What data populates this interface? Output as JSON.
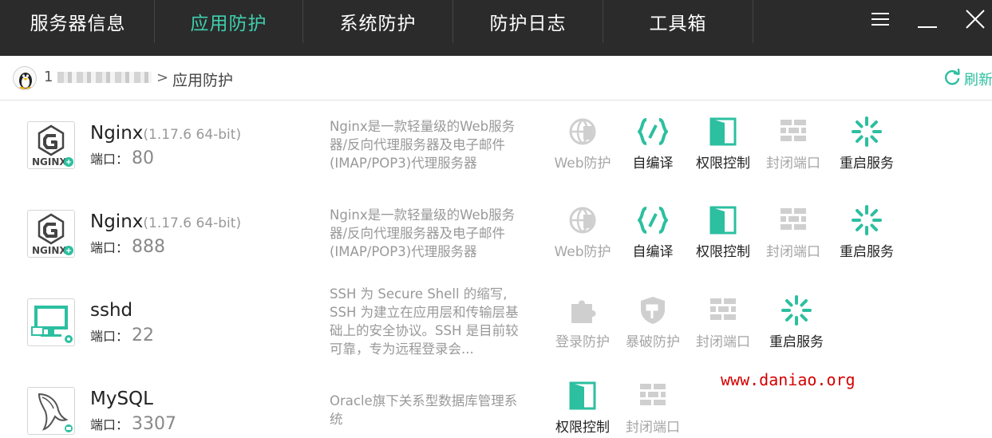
{
  "nav": {
    "tabs": [
      {
        "label": "服务器信息",
        "active": false
      },
      {
        "label": "应用防护",
        "active": true
      },
      {
        "label": "系统防护",
        "active": false
      },
      {
        "label": "防护日志",
        "active": false
      },
      {
        "label": "工具箱",
        "active": false
      }
    ]
  },
  "breadcrumb": {
    "host_prefix": "1",
    "host_suffix": "",
    "separator": ">",
    "page": "应用防护",
    "refresh_label": "刷新"
  },
  "colors": {
    "accent": "#3fd0b0",
    "icon_on": "#2cbfa0",
    "icon_off": "#cfcfcf",
    "nav_bg": "#2b2b2b",
    "watermark": "#d40000"
  },
  "apps": [
    {
      "name": "Nginx",
      "version": "(1.17.6 64-bit)",
      "port_label": "端口：",
      "port": "80",
      "description": "Nginx是一款轻量级的Web服务器/反向代理服务器及电子邮件(IMAP/POP3)代理服务器",
      "icon": "nginx-logo-icon",
      "actions": [
        {
          "label": "Web防护",
          "icon": "web-shield-icon",
          "enabled": false
        },
        {
          "label": "自编译",
          "icon": "code-braces-icon",
          "enabled": true
        },
        {
          "label": "权限控制",
          "icon": "door-icon",
          "enabled": true
        },
        {
          "label": "封闭端口",
          "icon": "brick-wall-icon",
          "enabled": false
        },
        {
          "label": "重启服务",
          "icon": "spinner-icon",
          "enabled": true
        }
      ]
    },
    {
      "name": "Nginx",
      "version": "(1.17.6 64-bit)",
      "port_label": "端口：",
      "port": "888",
      "description": "Nginx是一款轻量级的Web服务器/反向代理服务器及电子邮件(IMAP/POP3)代理服务器",
      "icon": "nginx-logo-icon",
      "actions": [
        {
          "label": "Web防护",
          "icon": "web-shield-icon",
          "enabled": false
        },
        {
          "label": "自编译",
          "icon": "code-braces-icon",
          "enabled": true
        },
        {
          "label": "权限控制",
          "icon": "door-icon",
          "enabled": true
        },
        {
          "label": "封闭端口",
          "icon": "brick-wall-icon",
          "enabled": false
        },
        {
          "label": "重启服务",
          "icon": "spinner-icon",
          "enabled": true
        }
      ]
    },
    {
      "name": "sshd",
      "version": "",
      "port_label": "端口：",
      "port": "22",
      "description": "SSH 为 Secure Shell 的缩写, SSH 为建立在应用层和传输层基础上的安全协议。SSH 是目前较可靠，专为远程登录会...",
      "icon": "monitor-icon",
      "actions": [
        {
          "label": "登录防护",
          "icon": "puzzle-icon",
          "enabled": false
        },
        {
          "label": "暴破防护",
          "icon": "hammer-shield-icon",
          "enabled": false
        },
        {
          "label": "封闭端口",
          "icon": "brick-wall-icon",
          "enabled": false
        },
        {
          "label": "重启服务",
          "icon": "spinner-icon",
          "enabled": true
        }
      ]
    },
    {
      "name": "MySQL",
      "version": "",
      "port_label": "端口：",
      "port": "3307",
      "description": "Oracle旗下关系型数据库管理系统",
      "icon": "dolphin-icon",
      "actions": [
        {
          "label": "权限控制",
          "icon": "door-icon",
          "enabled": true
        },
        {
          "label": "封闭端口",
          "icon": "brick-wall-icon",
          "enabled": false
        }
      ]
    }
  ],
  "watermark": "www.daniao.org"
}
